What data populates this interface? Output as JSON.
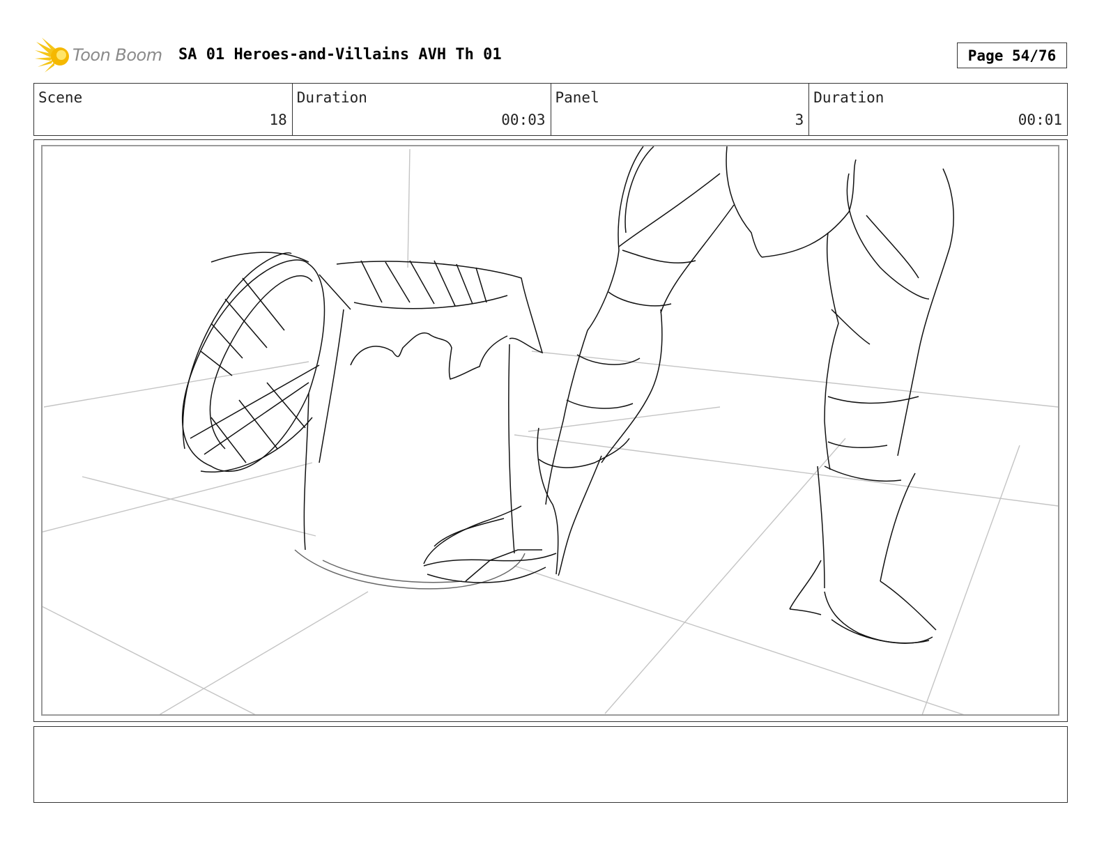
{
  "header": {
    "logo_text": "Toon Boom",
    "title": "SA 01 Heroes-and-Villains AVH Th 01",
    "page_label": "Page 54/76"
  },
  "info": {
    "scene_label": "Scene",
    "scene_value": "18",
    "scene_duration_label": "Duration",
    "scene_duration_value": "00:03",
    "panel_label": "Panel",
    "panel_value": "3",
    "panel_duration_label": "Duration",
    "panel_duration_value": "00:01"
  },
  "notes": {
    "text": ""
  },
  "colors": {
    "logo_star": "#f5c518",
    "logo_text": "#8a8a8a",
    "border": "#333333",
    "sketch_line": "#111111",
    "guide_line": "#c4c4c4"
  }
}
